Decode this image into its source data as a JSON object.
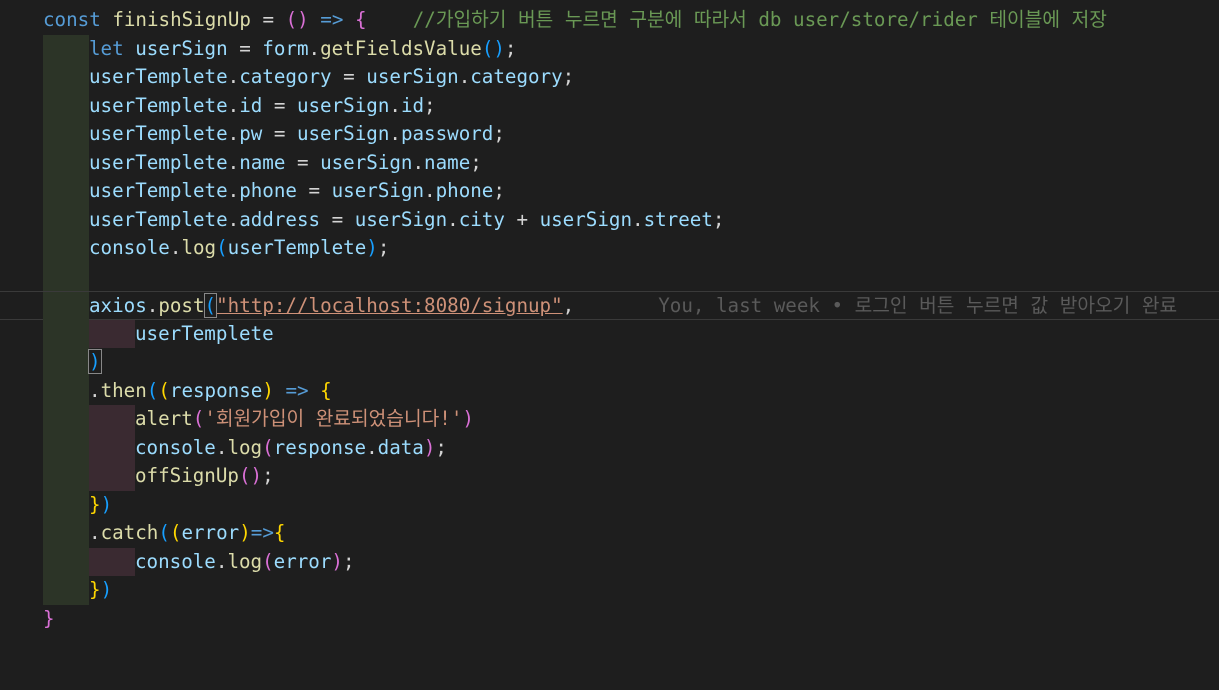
{
  "editor": {
    "line1": {
      "kw": "const",
      "name": "finishSignUp",
      "eq": " = ",
      "open_paren": "(",
      "close_paren": ")",
      "arrow": " => ",
      "brace": "{",
      "comment": "    //가입하기 버튼 누르면 구분에 따라서 db user/store/rider 테이블에 저장"
    },
    "line2": {
      "kw": "let",
      "var": "userSign",
      "eq": " = ",
      "obj": "form",
      "dot": ".",
      "method": "getFieldsValue",
      "paren": "()",
      "semi": ";"
    },
    "assignments": [
      {
        "left_obj": "userTemplete",
        "left_prop": "category",
        "right_obj": "userSign",
        "right_prop": "category",
        "tail": ";"
      },
      {
        "left_obj": "userTemplete",
        "left_prop": "id",
        "right_obj": "userSign",
        "right_prop": "id",
        "tail": ";"
      },
      {
        "left_obj": "userTemplete",
        "left_prop": "pw",
        "right_obj": "userSign",
        "right_prop": "password",
        "tail": ";"
      },
      {
        "left_obj": "userTemplete",
        "left_prop": "name",
        "right_obj": "userSign",
        "right_prop": "name",
        "tail": ";"
      },
      {
        "left_obj": "userTemplete",
        "left_prop": "phone",
        "right_obj": "userSign",
        "right_prop": "phone",
        "tail": ";"
      }
    ],
    "address_line": {
      "left_obj": "userTemplete",
      "left_prop": "address",
      "r1_obj": "userSign",
      "r1_prop": "city",
      "plus": " + ",
      "r2_obj": "userSign",
      "r2_prop": "street",
      "tail": ";"
    },
    "console_line": {
      "obj": "console",
      "method": "log",
      "open": "(",
      "arg": "userTemplete",
      "close": ")",
      "semi": ";"
    },
    "axios_line": {
      "obj": "axios",
      "method": "post",
      "open": "(",
      "url": "\"http://localhost:8080/signup\"",
      "comma": ",",
      "blame": "You, last week • 로그인 버튼 누르면 값 받아오기 완료"
    },
    "axios_arg": "userTemplete",
    "axios_close": ")",
    "then_line": {
      "dot": ".",
      "method": "then",
      "open": "(",
      "p_open": "(",
      "param": "response",
      "p_close": ")",
      "arrow": " => ",
      "brace": "{"
    },
    "alert_line": {
      "fn": "alert",
      "open": "(",
      "str": "'회원가입이 완료되었습니다!'",
      "close": ")"
    },
    "log_response": {
      "obj": "console",
      "method": "log",
      "open": "(",
      "arg_obj": "response",
      "arg_prop": "data",
      "close": ")",
      "semi": ";"
    },
    "offsign_line": {
      "fn": "offSignUp",
      "paren": "()",
      "semi": ";"
    },
    "then_close": {
      "brace": "}",
      "paren": ")"
    },
    "catch_line": {
      "dot": ".",
      "method": "catch",
      "open": "(",
      "p_open": "(",
      "param": "error",
      "p_close": ")",
      "arrow": "=>",
      "brace": "{"
    },
    "log_error": {
      "obj": "console",
      "method": "log",
      "open": "(",
      "arg": "error",
      "close": ")",
      "semi": ";"
    },
    "catch_close": {
      "brace": "}",
      "paren": ")"
    },
    "final_brace": "}"
  }
}
